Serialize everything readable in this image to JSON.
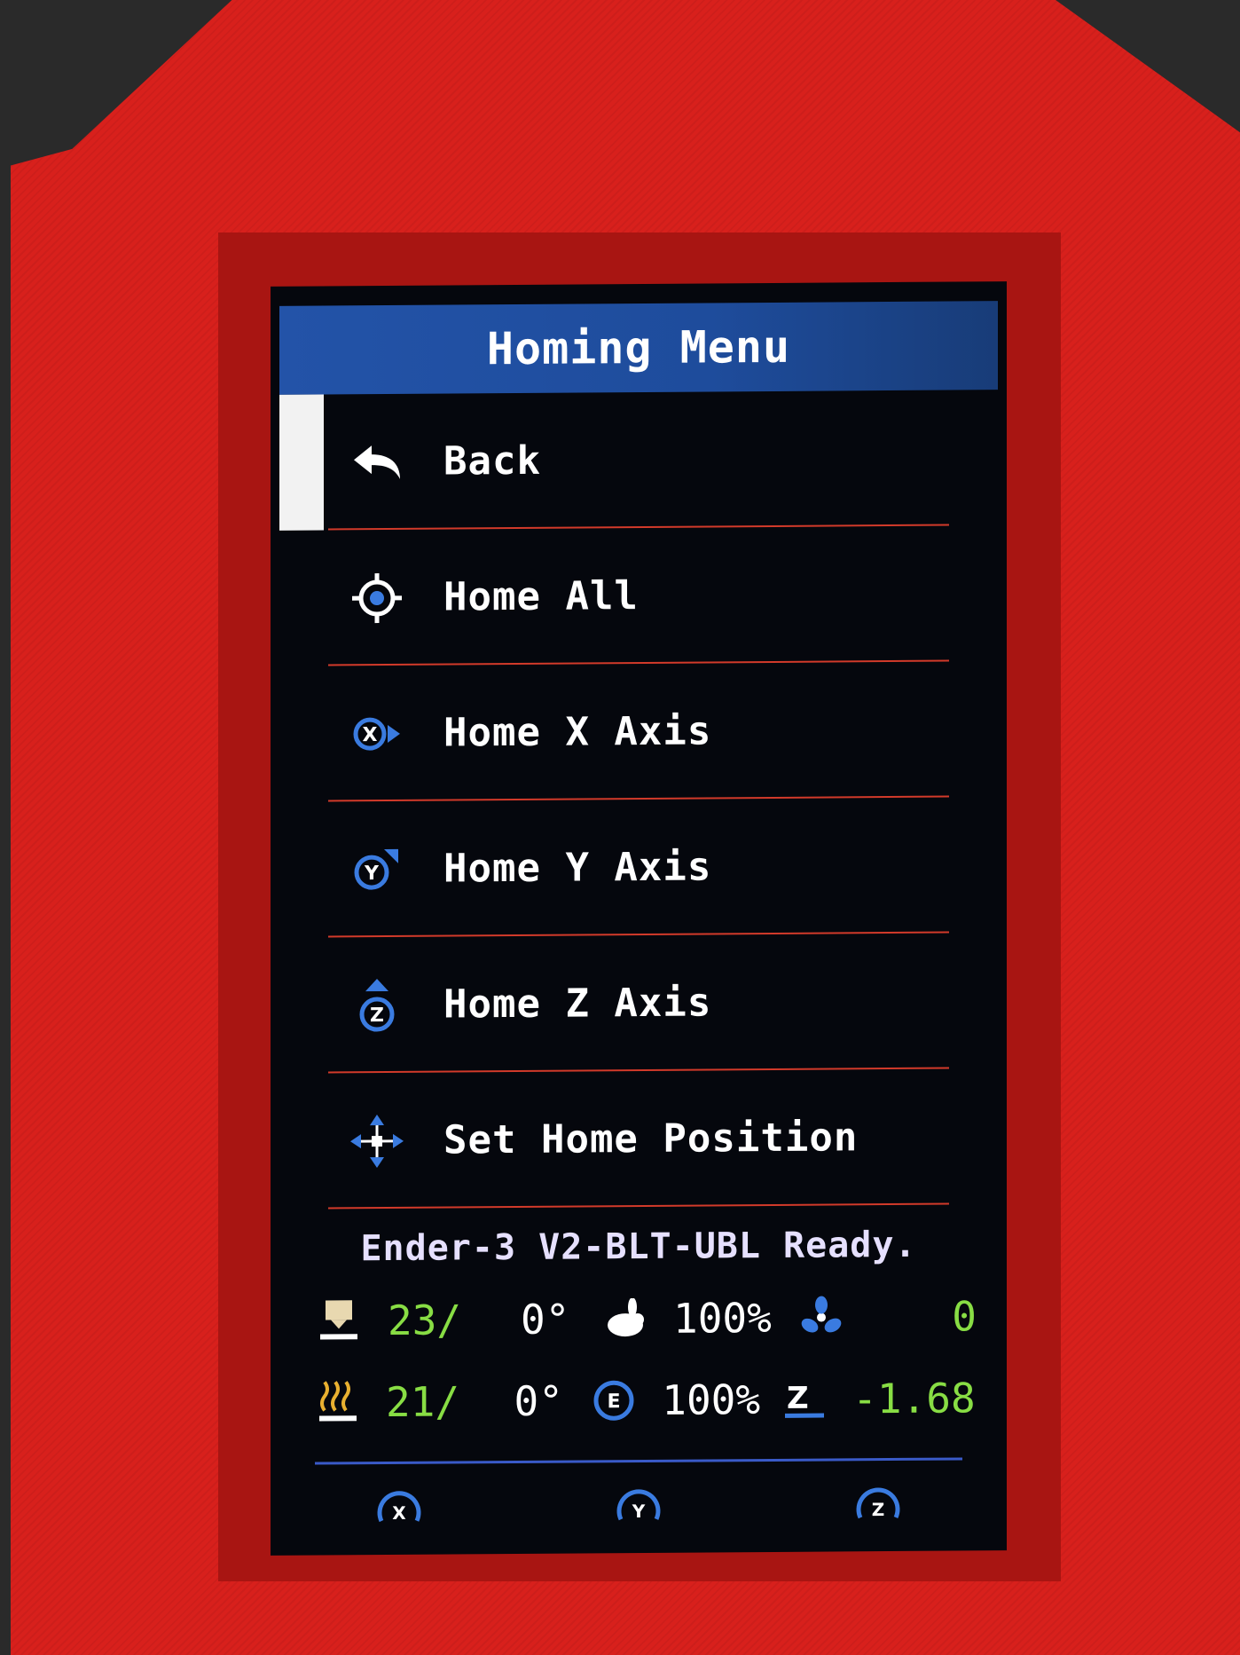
{
  "header": {
    "title": "Homing Menu"
  },
  "menu": {
    "items": [
      {
        "label": "Back",
        "icon": "back-arrow-icon"
      },
      {
        "label": "Home All",
        "icon": "target-icon"
      },
      {
        "label": "Home X Axis",
        "icon": "home-x-icon"
      },
      {
        "label": "Home Y Axis",
        "icon": "home-y-icon"
      },
      {
        "label": "Home Z Axis",
        "icon": "home-z-icon"
      },
      {
        "label": "Set Home Position",
        "icon": "move-cross-icon"
      }
    ],
    "selected_index": 0
  },
  "status": {
    "message": "Ender-3 V2-BLT-UBL Ready.",
    "hotend": {
      "current": "23/",
      "target": "0°"
    },
    "bed": {
      "current": "21/",
      "target": "0°"
    },
    "speed": "100%",
    "flow": "100%",
    "fan": "0",
    "z_offset": "-1.68",
    "z_label": "Z"
  },
  "axes": [
    "X",
    "Y",
    "Z"
  ],
  "colors": {
    "header": "#2353a8",
    "divider": "#d23a2a",
    "accent": "#3a7be0",
    "temp": "#88dd44",
    "enclosure": "#d8201c"
  }
}
